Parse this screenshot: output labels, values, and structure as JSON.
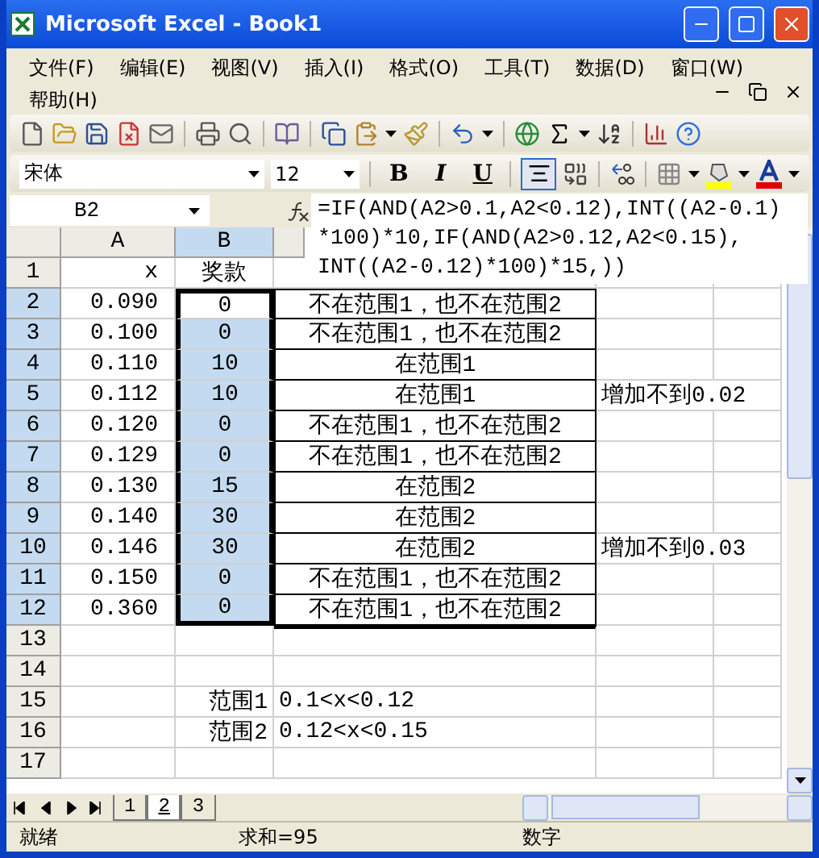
{
  "window": {
    "title": "Microsoft Excel - Book1"
  },
  "menu": [
    {
      "label": "文件(F)"
    },
    {
      "label": "编辑(E)"
    },
    {
      "label": "视图(V)"
    },
    {
      "label": "插入(I)"
    },
    {
      "label": "格式(O)"
    },
    {
      "label": "工具(T)"
    },
    {
      "label": "数据(D)"
    },
    {
      "label": "窗口(W)"
    },
    {
      "label": "帮助(H)"
    }
  ],
  "formatting": {
    "font": "宋体",
    "size": "12",
    "bold": "B",
    "italic": "I",
    "underline": "U",
    "center_pressed": true
  },
  "name_box": "B2",
  "formula_lines": [
    "=IF(AND(A2>0.1,A2<0.12),INT((A2-0.1)",
    "*100)*10,IF(AND(A2>0.12,A2<0.15),",
    "INT((A2-0.12)*100)*15,))"
  ],
  "columns": [
    {
      "label": "A",
      "selected": false
    },
    {
      "label": "B",
      "selected": true
    }
  ],
  "rows": [
    {
      "header": "1",
      "selected": false,
      "a": "x",
      "b": "奖款",
      "bordered": false
    },
    {
      "header": "2",
      "selected": true,
      "a": "0.090",
      "b": "0",
      "c": "不在范围1，也不在范围2",
      "bordered": true
    },
    {
      "header": "3",
      "selected": true,
      "a": "0.100",
      "b": "0",
      "c": "不在范围1，也不在范围2",
      "bordered": true
    },
    {
      "header": "4",
      "selected": true,
      "a": "0.110",
      "b": "10",
      "c": "在范围1",
      "bordered": true
    },
    {
      "header": "5",
      "selected": true,
      "a": "0.112",
      "b": "10",
      "c": "在范围1",
      "d": "增加不到0.02",
      "bordered": true
    },
    {
      "header": "6",
      "selected": true,
      "a": "0.120",
      "b": "0",
      "c": "不在范围1，也不在范围2",
      "bordered": true
    },
    {
      "header": "7",
      "selected": true,
      "a": "0.129",
      "b": "0",
      "c": "不在范围1，也不在范围2",
      "bordered": true
    },
    {
      "header": "8",
      "selected": true,
      "a": "0.130",
      "b": "15",
      "c": "在范围2",
      "bordered": true
    },
    {
      "header": "9",
      "selected": true,
      "a": "0.140",
      "b": "30",
      "c": "在范围2",
      "bordered": true
    },
    {
      "header": "10",
      "selected": true,
      "a": "0.146",
      "b": "30",
      "c": "在范围2",
      "d": "增加不到0.03",
      "bordered": true
    },
    {
      "header": "11",
      "selected": true,
      "a": "0.150",
      "b": "0",
      "c": "不在范围1，也不在范围2",
      "bordered": true
    },
    {
      "header": "12",
      "selected": true,
      "a": "0.360",
      "b": "0",
      "c": "不在范围1，也不在范围2",
      "bordered": true
    },
    {
      "header": "13",
      "selected": false,
      "bordered": false
    },
    {
      "header": "14",
      "selected": false,
      "bordered": false
    },
    {
      "header": "15",
      "selected": false,
      "b": "范围1",
      "c": "0.1<x<0.12",
      "bordered": false
    },
    {
      "header": "16",
      "selected": false,
      "b": "范围2",
      "c": "0.12<x<0.15",
      "bordered": false
    },
    {
      "header": "17",
      "selected": false,
      "bordered": false
    }
  ],
  "sheet_tabs": [
    {
      "label": "1",
      "selected": false
    },
    {
      "label": "2",
      "selected": true
    },
    {
      "label": "3",
      "selected": false
    }
  ],
  "status_bar": {
    "state": "就绪",
    "sum": "求和=95",
    "mode": "数字"
  }
}
